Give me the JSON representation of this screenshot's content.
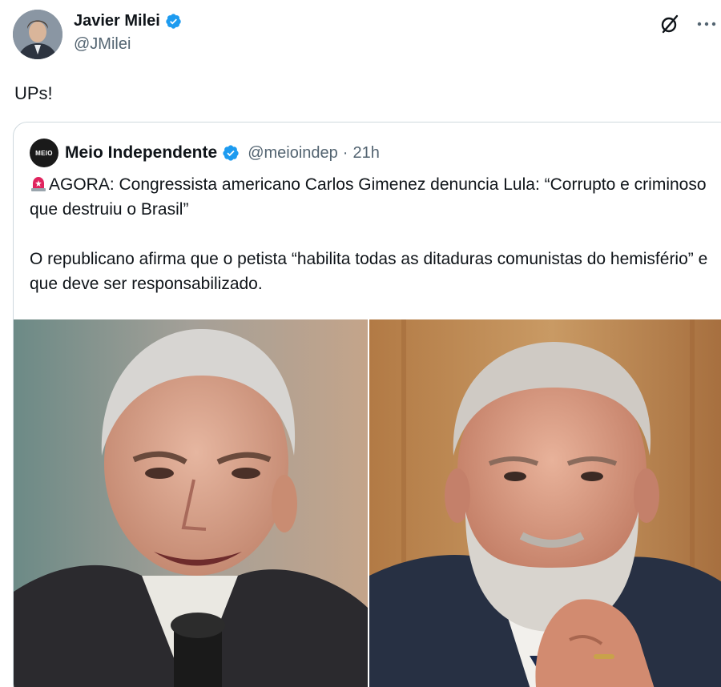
{
  "tweet": {
    "author": {
      "display_name": "Javier Milei",
      "handle": "@JMilei",
      "verified": true
    },
    "text": "UPs!",
    "icons": {
      "grok": "grok-slash-circle-icon",
      "more": "more-dots-icon"
    }
  },
  "quote": {
    "author": {
      "display_name": "Meio Independente",
      "handle": "@meioindep",
      "separator": "·",
      "time": "21h",
      "avatar_text": "MEIO"
    },
    "paragraph1": "AGORA: Congressista americano Carlos Gimenez denuncia Lula: “Corrupto e criminoso que destruiu o Brasil”",
    "paragraph2": "O republicano afirma que o petista “habilita todas as ditaduras comunistas do hemisfério” e que deve ser responsabilizado.",
    "leading_icon": "siren-icon",
    "media": [
      {
        "name": "photo-left",
        "subject": "man with white hair speaking at microphone"
      },
      {
        "name": "photo-right",
        "subject": "man with white beard, hand on chin"
      }
    ]
  },
  "colors": {
    "verified_blue": "#1d9bf0",
    "text_primary": "#0f1419",
    "text_secondary": "#536471",
    "border": "#cfd9de"
  }
}
